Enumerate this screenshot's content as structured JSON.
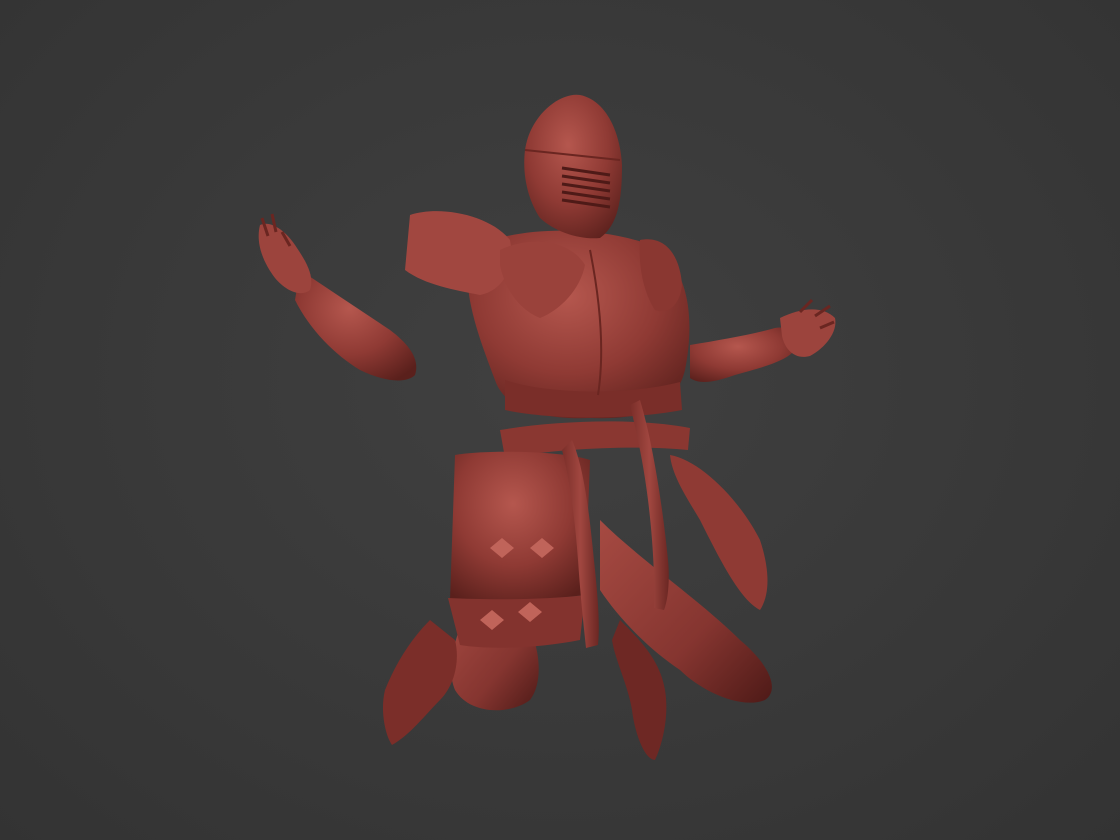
{
  "viewport": {
    "background_color": "#3b3b3b"
  },
  "model": {
    "subject": "armored-knight-sculpt",
    "material_color": "#8f3a34",
    "highlight_color": "#b5574e",
    "shadow_color": "#4e1a17"
  }
}
